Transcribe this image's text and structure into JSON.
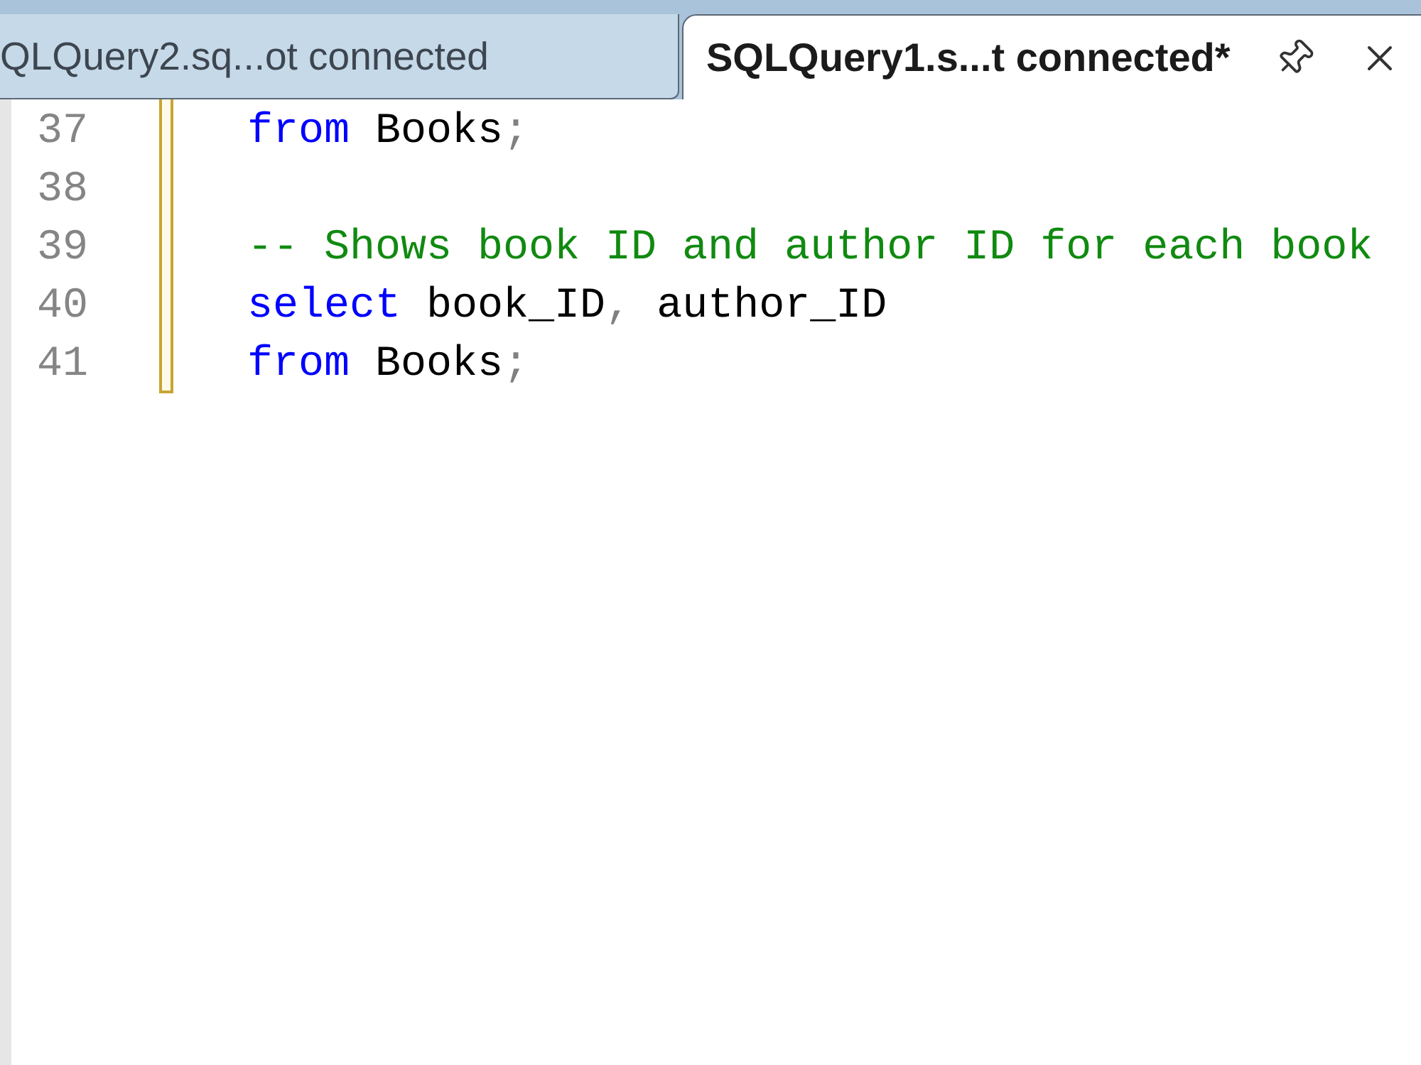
{
  "tabs": [
    {
      "label": "QLQuery2.sq...ot connected",
      "selected": false
    },
    {
      "label": "SQLQuery1.s...t connected*",
      "selected": true
    }
  ],
  "editor": {
    "lines": [
      {
        "number": "37",
        "modified": true,
        "tokens": [
          {
            "kind": "keyword",
            "text": "from"
          },
          {
            "kind": "plain",
            "text": " Books"
          },
          {
            "kind": "punct",
            "text": ";"
          }
        ]
      },
      {
        "number": "38",
        "modified": true
      },
      {
        "number": "39",
        "modified": true,
        "tokens": [
          {
            "kind": "comment",
            "text": "-- Shows book ID and author ID for each book"
          }
        ]
      },
      {
        "number": "40",
        "modified": true,
        "tokens": [
          {
            "kind": "keyword",
            "text": "select"
          },
          {
            "kind": "plain",
            "text": " book_ID"
          },
          {
            "kind": "punct",
            "text": ","
          },
          {
            "kind": "plain",
            "text": " author_ID"
          }
        ]
      },
      {
        "number": "41",
        "modified": true,
        "tokens": [
          {
            "kind": "keyword",
            "text": "from"
          },
          {
            "kind": "plain",
            "text": " Books"
          },
          {
            "kind": "punct",
            "text": ";"
          }
        ]
      }
    ]
  }
}
